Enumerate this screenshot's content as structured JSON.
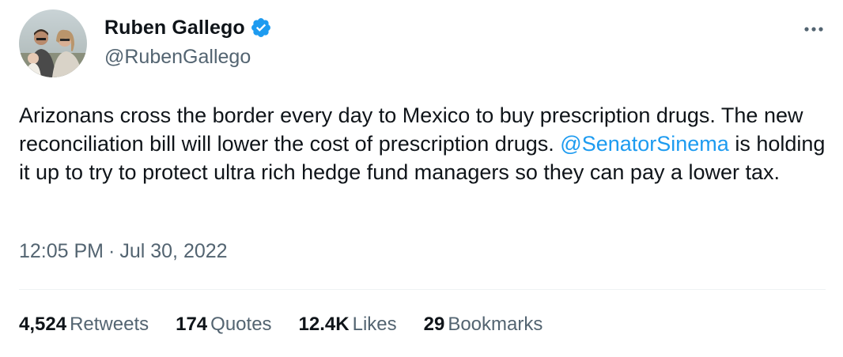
{
  "author": {
    "display_name": "Ruben Gallego",
    "handle": "@RubenGallego",
    "verified": true,
    "avatar_icon": "profile-photo"
  },
  "tweet": {
    "text_before": "Arizonans cross the border every day to Mexico to buy prescription drugs. The new reconciliation bill will lower the cost of prescription drugs. ",
    "mention": "@SenatorSinema",
    "text_after": " is holding it up to try to protect ultra rich hedge fund managers so they can pay a lower tax.",
    "time": "12:05 PM",
    "separator": "·",
    "date": "Jul 30, 2022"
  },
  "stats": {
    "retweets": {
      "count": "4,524",
      "label": "Retweets"
    },
    "quotes": {
      "count": "174",
      "label": "Quotes"
    },
    "likes": {
      "count": "12.4K",
      "label": "Likes"
    },
    "bookmarks": {
      "count": "29",
      "label": "Bookmarks"
    }
  },
  "colors": {
    "text": "#0f1419",
    "secondary": "#536471",
    "accent": "#1d9bf0",
    "divider": "#eff3f4"
  },
  "icons": {
    "verified": "verified-badge-icon",
    "more": "more-options-icon"
  }
}
